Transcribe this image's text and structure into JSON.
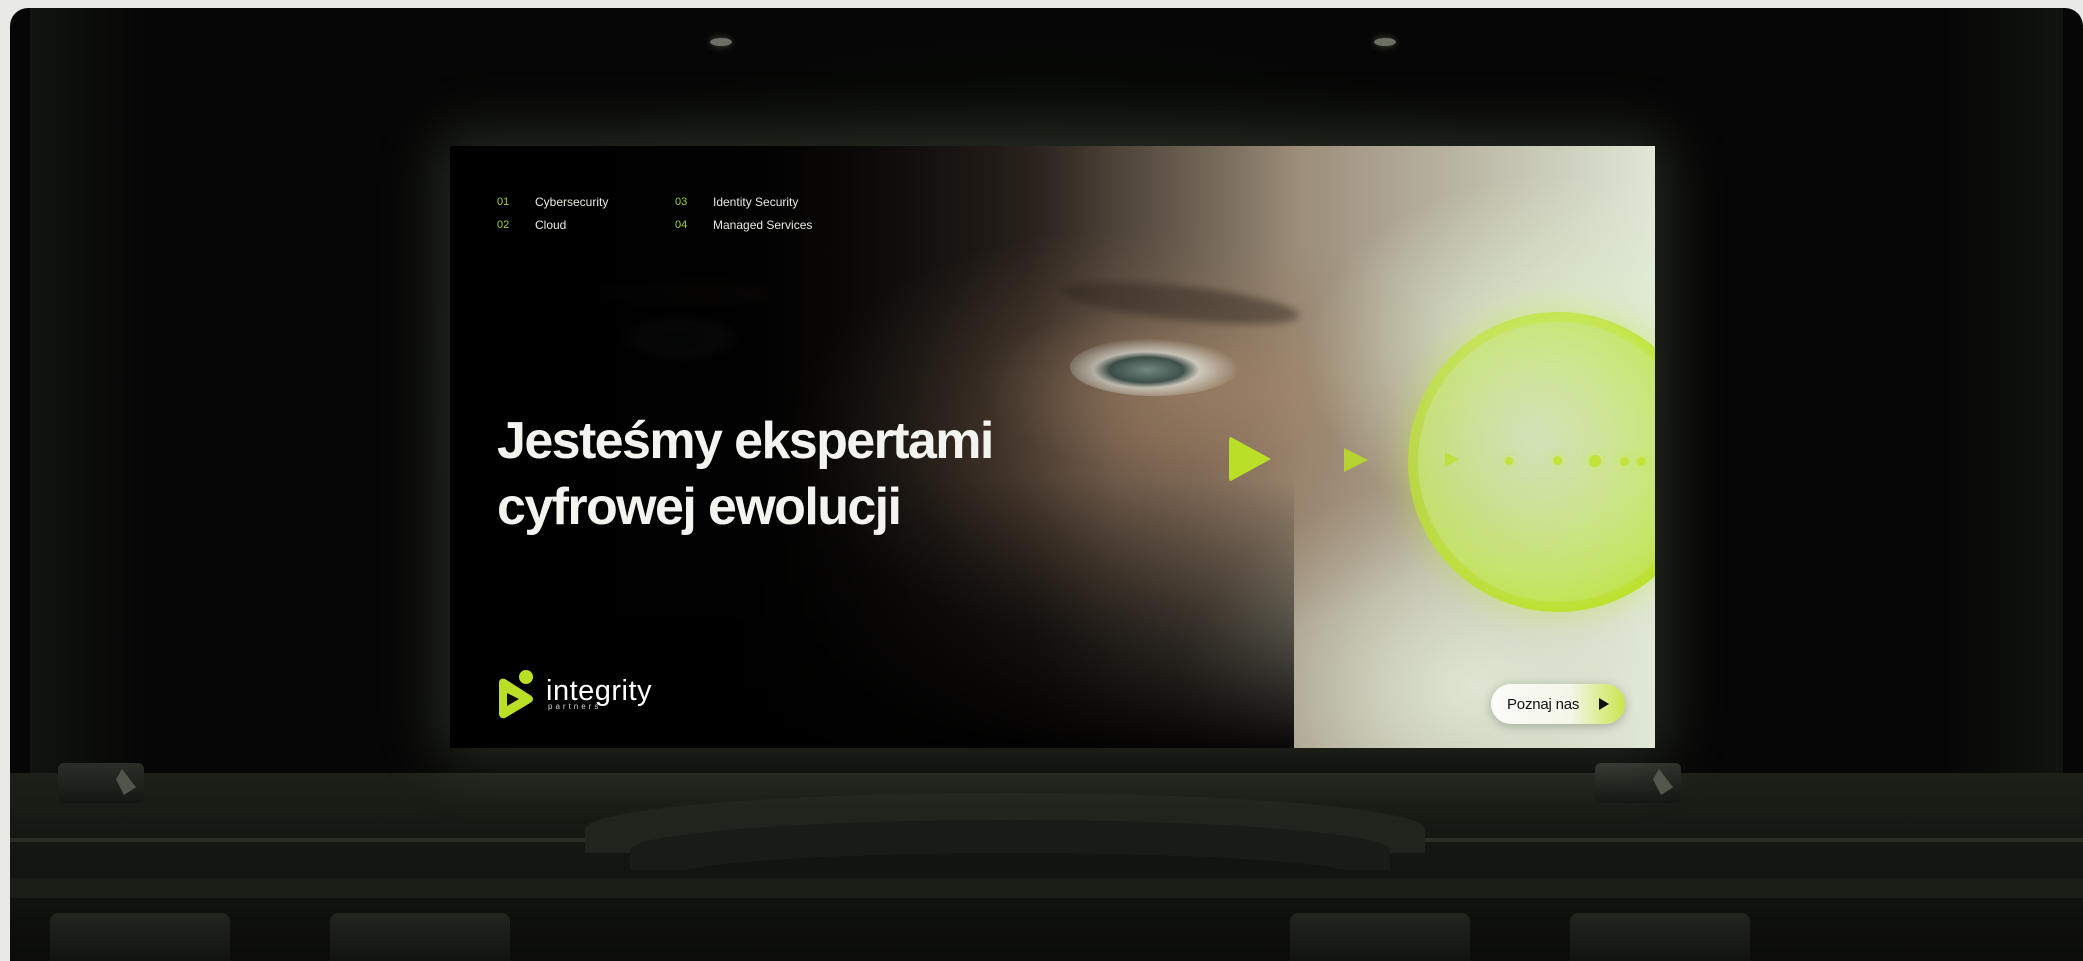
{
  "nav": {
    "col1": [
      {
        "num": "01",
        "label": "Cybersecurity"
      },
      {
        "num": "02",
        "label": "Cloud"
      }
    ],
    "col2": [
      {
        "num": "03",
        "label": "Identity Security"
      },
      {
        "num": "04",
        "label": "Managed Services"
      }
    ]
  },
  "hero": {
    "headline_line1": "Jesteśmy ekspertami",
    "headline_line2": "cyfrowej ewolucji"
  },
  "logo": {
    "name": "integrity",
    "sub": "partners"
  },
  "cta": {
    "label": "Poznaj nas"
  },
  "colors": {
    "accent": "#b9e027",
    "text": "#f3f4ef",
    "background": "#040404"
  },
  "icons": {
    "logo_mark": "integrity-logo-icon",
    "cta_arrow": "play-arrow-icon",
    "decorative": "play-triangle-icon"
  }
}
